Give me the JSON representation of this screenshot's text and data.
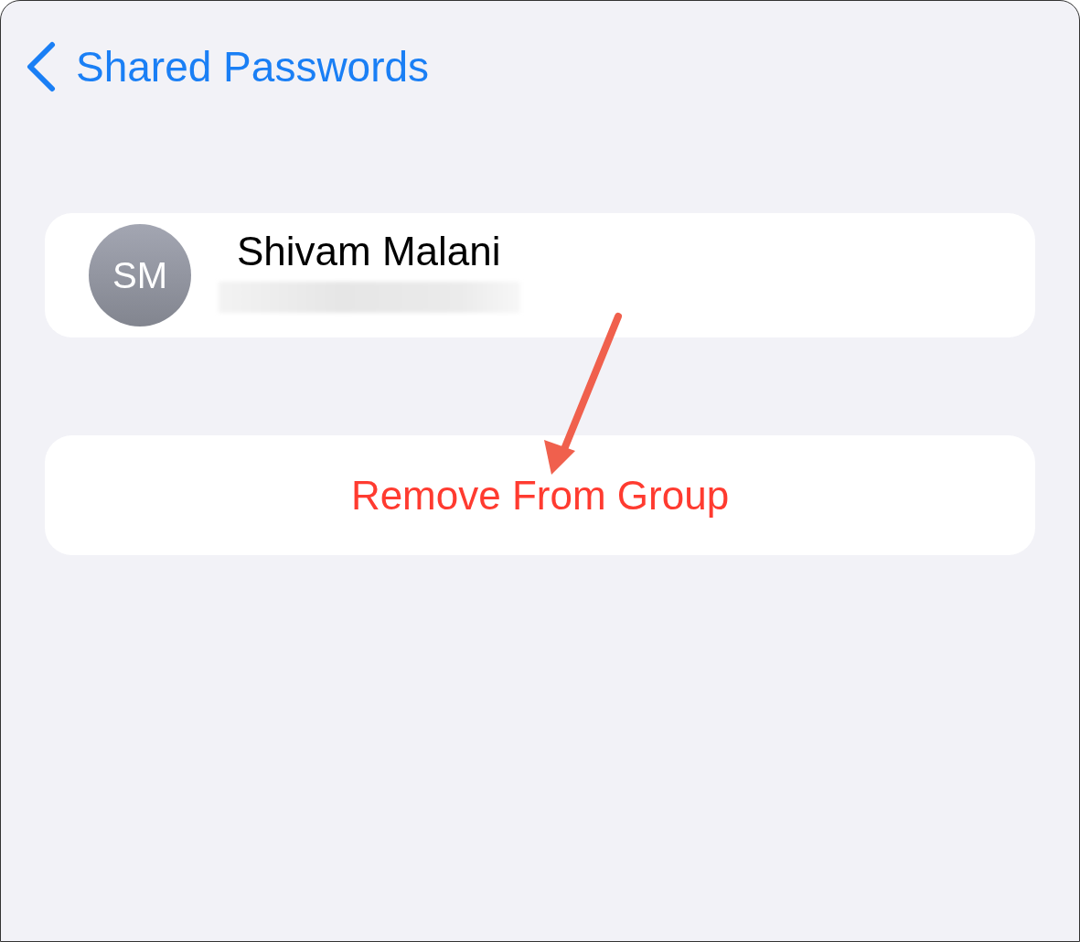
{
  "nav": {
    "back_title": "Shared Passwords"
  },
  "member": {
    "initials": "SM",
    "name": "Shivam Malani"
  },
  "action": {
    "label": "Remove From Group"
  }
}
